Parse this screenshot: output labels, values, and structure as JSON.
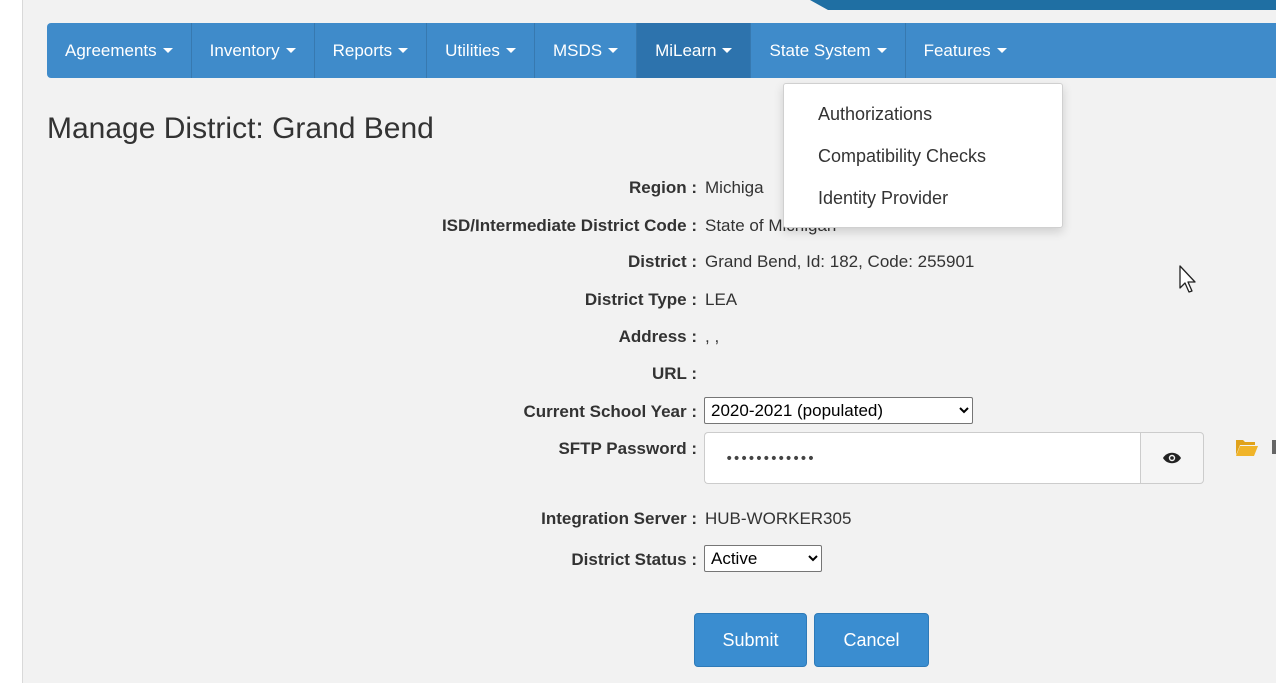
{
  "nav": {
    "items": [
      {
        "label": "Agreements"
      },
      {
        "label": "Inventory"
      },
      {
        "label": "Reports"
      },
      {
        "label": "Utilities"
      },
      {
        "label": "MSDS"
      },
      {
        "label": "MiLearn"
      },
      {
        "label": "State System"
      },
      {
        "label": "Features"
      }
    ],
    "active_item": "MiLearn",
    "bar_color": "#3f8bca",
    "active_color": "#2d73ad"
  },
  "dropdown": {
    "items": [
      {
        "label": "Authorizations"
      },
      {
        "label": "Compatibility Checks"
      },
      {
        "label": "Identity Provider"
      }
    ]
  },
  "page": {
    "title": "Manage District: Grand Bend"
  },
  "fields": {
    "region": {
      "label": "Region :",
      "value": "Michiga"
    },
    "isd": {
      "label": "ISD/Intermediate District Code :",
      "value": "State of Michigan"
    },
    "district": {
      "label": "District :",
      "value": "Grand Bend, Id: 182, Code: 255901"
    },
    "district_type": {
      "label": "District Type :",
      "value": "LEA"
    },
    "address": {
      "label": "Address :",
      "value": ", ,"
    },
    "url": {
      "label": "URL :",
      "value": ""
    },
    "school_year": {
      "label": "Current School Year :",
      "value": "2020-2021 (populated)"
    },
    "sftp_password": {
      "label": "SFTP Password :",
      "value": "••••••••••••"
    },
    "integration_server": {
      "label": "Integration Server :",
      "value": "HUB-WORKER305"
    },
    "district_status": {
      "label": "District Status :",
      "value": "Active"
    }
  },
  "buttons": {
    "submit": "Submit",
    "cancel": "Cancel",
    "color": "#3a8dd0"
  },
  "icons": {
    "eye": "eye-icon",
    "folder": "folder-open-icon",
    "cursor": "mouse-pointer-icon"
  }
}
